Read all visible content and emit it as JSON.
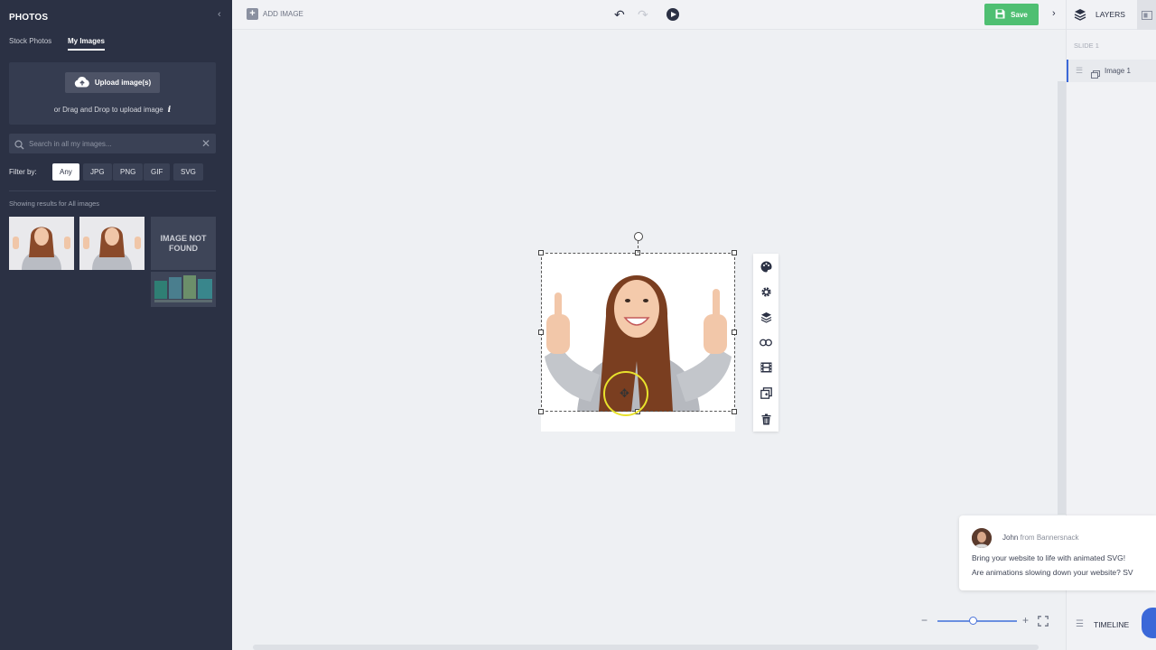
{
  "left_panel": {
    "title": "PHOTOS",
    "tabs": [
      {
        "label": "Stock Photos",
        "active": false
      },
      {
        "label": "My Images",
        "active": true
      }
    ],
    "upload_button": "Upload image(s)",
    "upload_hint": "or Drag and Drop to upload image",
    "info_icon": "i",
    "search_placeholder": "Search in all my images...",
    "filter_label": "Filter by:",
    "filters": [
      {
        "label": "Any",
        "active": true
      },
      {
        "label": "JPG",
        "active": false
      },
      {
        "label": "PNG",
        "active": false
      },
      {
        "label": "GIF",
        "active": false
      },
      {
        "label": "SVG",
        "active": false
      }
    ],
    "results_label": "Showing results for All images",
    "image_not_found": "IMAGE NOT FOUND"
  },
  "toolbar": {
    "add_image": "ADD IMAGE",
    "save": "Save",
    "icons": [
      "plus-icon",
      "undo-icon",
      "redo-icon",
      "play-icon",
      "save-icon",
      "chevron-right-icon"
    ]
  },
  "right_panel": {
    "layers_label": "LAYERS",
    "slide_label": "SLIDE 1",
    "layers": [
      {
        "name": "Image 1"
      }
    ],
    "timeline_label": "TIMELINE"
  },
  "context_toolbar": {
    "icons": [
      "palette-icon",
      "gear-icon",
      "layers-icon",
      "link-icon",
      "filmstrip-icon",
      "duplicate-icon",
      "trash-icon"
    ]
  },
  "chat": {
    "sender": "John",
    "sender_suffix": "from Bannersnack",
    "line1": "Bring your website to life with animated SVG!",
    "line2": "Are animations slowing down your website? SV"
  },
  "colors": {
    "panel_dark": "#2b3144",
    "save_green": "#4fbf72",
    "accent_blue": "#3b68d8",
    "cursor_yellow": "#e8e22c"
  }
}
